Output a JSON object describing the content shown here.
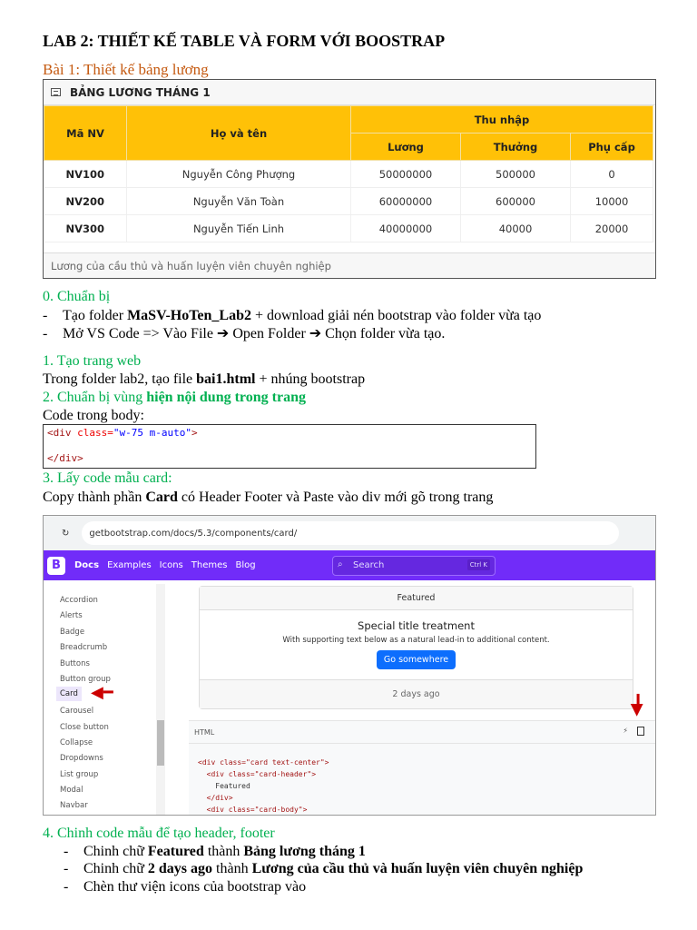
{
  "title": "LAB 2: THIẾT KẾ TABLE VÀ FORM VỚI BOOSTRAP",
  "bai1": "Bài 1: Thiết kế bảng lương",
  "card": {
    "header": "BẢNG LƯƠNG THÁNG 1",
    "footer": "Lương của cầu thủ và huấn luyện viên chuyên nghiệp",
    "columns": {
      "ma": "Mã NV",
      "ten": "Họ và tên",
      "thu_nhap": "Thu nhập",
      "luong": "Lương",
      "thuong": "Thưởng",
      "phu_cap": "Phụ cấp"
    },
    "rows": [
      {
        "ma": "NV100",
        "ten": "Nguyễn Công Phượng",
        "luong": "50000000",
        "thuong": "500000",
        "phu_cap": "0"
      },
      {
        "ma": "NV200",
        "ten": "Nguyễn Văn Toàn",
        "luong": "60000000",
        "thuong": "600000",
        "phu_cap": "10000"
      },
      {
        "ma": "NV300",
        "ten": "Nguyễn Tiến Linh",
        "luong": "40000000",
        "thuong": "40000",
        "phu_cap": "20000"
      }
    ]
  },
  "s0": {
    "heading": "0. Chuẩn bị",
    "l1a": "Tạo folder ",
    "l1b": "MaSV-HoTen_Lab2",
    "l1c": " +  download giải nén bootstrap vào folder vừa tạo",
    "l2": "Mở VS Code => Vào File ➔ Open Folder ➔ Chọn folder vừa tạo."
  },
  "s1": {
    "heading": "1. Tạo trang web",
    "a": "Trong folder lab2, tạo file ",
    "b": "bai1.html",
    "c": " + nhúng bootstrap"
  },
  "s2": {
    "heading_a": "2. Chuẩn bị vùng ",
    "heading_b": "hiện nội dung trong trang",
    "text": "Code trong body:"
  },
  "code": {
    "open_tag": "<div ",
    "attr": "class=",
    "val": "\"w-75 m-auto\"",
    "gt": ">",
    "close": "</div>"
  },
  "s3": {
    "heading": "3. Lấy code mẫu card:",
    "a": "Copy thành phần ",
    "b": "Card",
    "c": " có Header Footer và Paste vào div mới gõ trong trang"
  },
  "shot": {
    "url": "getbootstrap.com/docs/5.3/components/card/",
    "logo": "B",
    "nav": [
      "Docs",
      "Examples",
      "Icons",
      "Themes",
      "Blog"
    ],
    "search": "Search",
    "kbd": "Ctrl K",
    "sidebar": [
      "Accordion",
      "Alerts",
      "Badge",
      "Breadcrumb",
      "Buttons",
      "Button group",
      "Card",
      "Carousel",
      "Close button",
      "Collapse",
      "Dropdowns",
      "List group",
      "Modal",
      "Navbar"
    ],
    "demo": {
      "header": "Featured",
      "title": "Special title treatment",
      "text": "With supporting text below as a natural lead-in to additional content.",
      "button": "Go somewhere",
      "footer": "2 days ago"
    },
    "html_label": "HTML",
    "code": [
      "<div class=\"card text-center\">",
      "  <div class=\"card-header\">",
      "    Featured",
      "  </div>",
      "  <div class=\"card-body\">"
    ]
  },
  "s4": {
    "heading": "4. Chinh code mẫu để tạo header, footer",
    "b1a": "Chinh chữ ",
    "b1b": "Featured",
    "b1c": " thành ",
    "b1d": "Bảng lương tháng 1",
    "b2a": "Chinh chữ ",
    "b2b": "2 days ago",
    "b2c": " thành ",
    "b2d": "Lương của cầu thủ và huấn luyện viên chuyên nghiệp",
    "b3": "Chèn thư viện icons của bootstrap vào"
  }
}
